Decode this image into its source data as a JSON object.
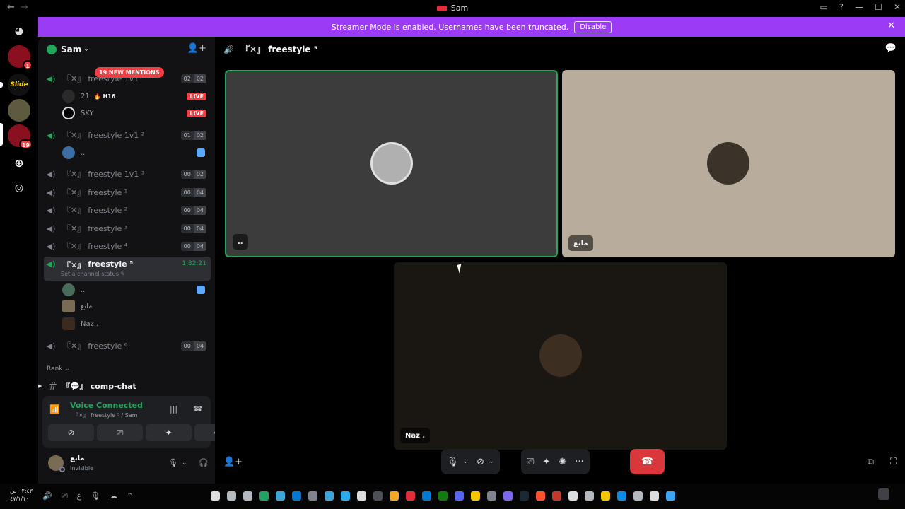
{
  "window": {
    "title": "Sam",
    "back": "←",
    "forward": "→",
    "buttons": [
      "▭",
      "?",
      "—",
      "☐",
      "✕"
    ]
  },
  "servers": {
    "badge1": "1",
    "badge2": "19",
    "slide_label": "Slide"
  },
  "banner": {
    "text": "Streamer Mode is enabled. Usernames have been truncated.",
    "disable_label": "Disable",
    "close": "✕"
  },
  "server": {
    "name": "Sam",
    "chevron": "⌄",
    "invite_icon": "👤+"
  },
  "mentions": "19 NEW MENTIONS",
  "channels": [
    {
      "prefix": "『✕』",
      "name": "freestyle 1v1",
      "count_a": "02",
      "count_b": "02",
      "active": true
    },
    {
      "prefix": "『✕』",
      "name": "freestyle 1v1 ²",
      "count_a": "01",
      "count_b": "02",
      "active": true
    },
    {
      "prefix": "『✕』",
      "name": "freestyle 1v1 ³",
      "count_a": "00",
      "count_b": "02",
      "active": false
    },
    {
      "prefix": "『✕』",
      "name": "freestyle ¹",
      "count_a": "00",
      "count_b": "04",
      "active": false
    },
    {
      "prefix": "『✕』",
      "name": "freestyle ²",
      "count_a": "00",
      "count_b": "04",
      "active": false
    },
    {
      "prefix": "『✕』",
      "name": "freestyle ³",
      "count_a": "00",
      "count_b": "04",
      "active": false
    },
    {
      "prefix": "『✕』",
      "name": "freestyle ⁴",
      "count_a": "00",
      "count_b": "04",
      "active": false
    },
    {
      "prefix": "『✕』",
      "name": "freestyle ⁵",
      "timer": "1:32:21",
      "status": "Set a channel status ✎",
      "active": true
    },
    {
      "prefix": "『✕』",
      "name": "freestyle ⁶",
      "count_a": "00",
      "count_b": "04",
      "active": false
    }
  ],
  "members": {
    "m1": {
      "name": "21",
      "tag": "🔥 H16",
      "live": "LIVE"
    },
    "m2": {
      "name": "SKY",
      "live": "LIVE"
    },
    "m3": {
      "name": ".."
    },
    "m4": {
      "name": ".."
    },
    "m5": {
      "name": "مانع"
    },
    "m6": {
      "name": "Naz ."
    }
  },
  "category": "Rank ⌄",
  "text_channel": {
    "prefix": "『💬』",
    "name": "comp-chat",
    "hash": "#",
    "arrow": "▶"
  },
  "voice": {
    "title": "Voice Connected",
    "subtitle": "『✕』 freestyle ⁵ / Sam",
    "signal": "📶",
    "wave": "|||",
    "disconnect": "☎",
    "btn_camera": "⊘",
    "btn_share": "⎚",
    "btn_activity": "✦",
    "btn_sound": "✺"
  },
  "user": {
    "name": "مانع",
    "status": "Invisible",
    "mic": "🎙",
    "headset": "🎧",
    "settings": "⚙",
    "dropdown": "⌄"
  },
  "stage": {
    "channel_icon": "🔊",
    "channel_name": "『✕』 freestyle ⁵",
    "chat_icon": "💬",
    "tiles": [
      {
        "label": ".."
      },
      {
        "label": "مانع"
      },
      {
        "label": "Naz ."
      }
    ],
    "controls": {
      "mic": "🎙",
      "camera": "⊘",
      "share": "⎚",
      "activity": "✦",
      "soundboard": "✺",
      "more": "···",
      "end": "☎",
      "dropdown": "⌄"
    },
    "add_user": "👤+",
    "popout": "⧉",
    "fullscreen": "⛶"
  },
  "taskbar": {
    "time": "٠٢:٤٣ ص",
    "date": "٤٧/١/١٠",
    "sys_icons": [
      "🔊",
      "⎚",
      "ع",
      "🎙",
      "☁",
      "⌃"
    ]
  },
  "colors": {
    "accent_green": "#23a55a",
    "banner": "#9b3cf4",
    "danger": "#f23f43",
    "end_call": "#da373c"
  }
}
